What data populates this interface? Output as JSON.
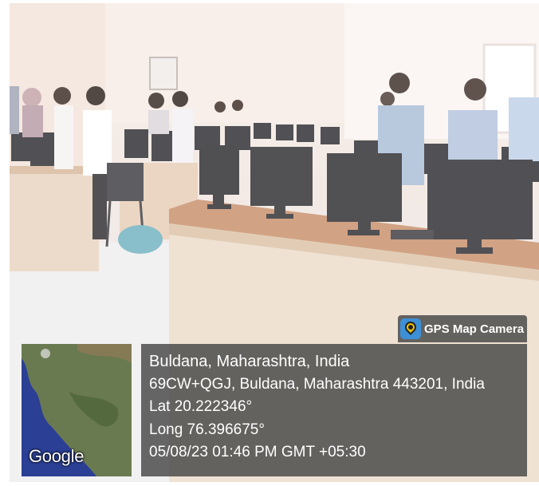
{
  "watermark": {
    "app_name": "GPS Map Camera",
    "icon": "gps-map-camera-icon",
    "map_label": "Google",
    "location_title": "Buldana, Maharashtra, India",
    "address": "69CW+QGJ, Buldana, Maharashtra 443201, India",
    "latitude": "Lat 20.222346°",
    "longitude": "Long 76.396675°",
    "timestamp": "05/08/23 01:46 PM GMT +05:30"
  },
  "colors": {
    "overlay": "#464646",
    "badge_icon": "#3d8fd6",
    "map_water": "#2b3f95",
    "map_land": "#6a7a50"
  }
}
